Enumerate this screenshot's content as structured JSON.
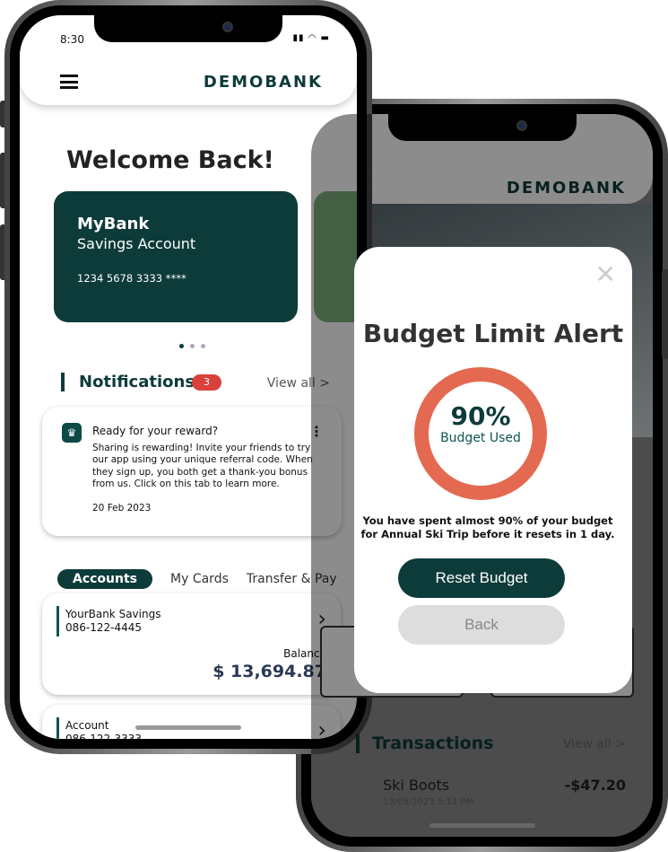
{
  "back_phone": {
    "brand": "DEMOBANK",
    "modal": {
      "title": "Budget Limit Alert",
      "percent": "90%",
      "percent_value": 90,
      "percent_label": "Budget Used",
      "message": "You have spent almost 90% of your budget for Annual Ski Trip before it resets in 1 day.",
      "reset_label": "Reset Budget",
      "back_label": "Back",
      "close_icon": "close-icon",
      "ring_color": "#e36a51"
    },
    "transactions": {
      "title": "Transactions",
      "view_all": "View all >",
      "items": [
        {
          "name": "Ski Boots",
          "amount": "-$47.20",
          "date": "13/05/2023   5:12 PM"
        }
      ]
    }
  },
  "front_phone": {
    "status": {
      "time": "8:30"
    },
    "brand": "DEMOBANK",
    "welcome": "Welcome Back!",
    "card": {
      "bank": "MyBank",
      "type": "Savings Account",
      "number": "1234 5678 3333 ****",
      "color": "#0d3b3a"
    },
    "notifications": {
      "title": "Notifications",
      "count": "3",
      "view_all": "View all >",
      "item": {
        "title": "Ready for your reward?",
        "body": "Sharing is rewarding! Invite your friends to try our app using your unique referral code. When they sign up, you both get a thank-you bonus from us. Click on this tab to learn more.",
        "date": "20 Feb 2023"
      }
    },
    "tabs": [
      "Accounts",
      "My Cards",
      "Transfer & Pay"
    ],
    "accounts": [
      {
        "name": "YourBank Savings",
        "number": "086-122-4445",
        "balance_label": "Balance",
        "balance": "$ 13,694.87"
      },
      {
        "name": "Account",
        "number": "086-122-3333"
      }
    ]
  },
  "colors": {
    "brand": "#0d3b3a",
    "badge": "#d9413a",
    "secondary_card": "#7fae7c"
  }
}
